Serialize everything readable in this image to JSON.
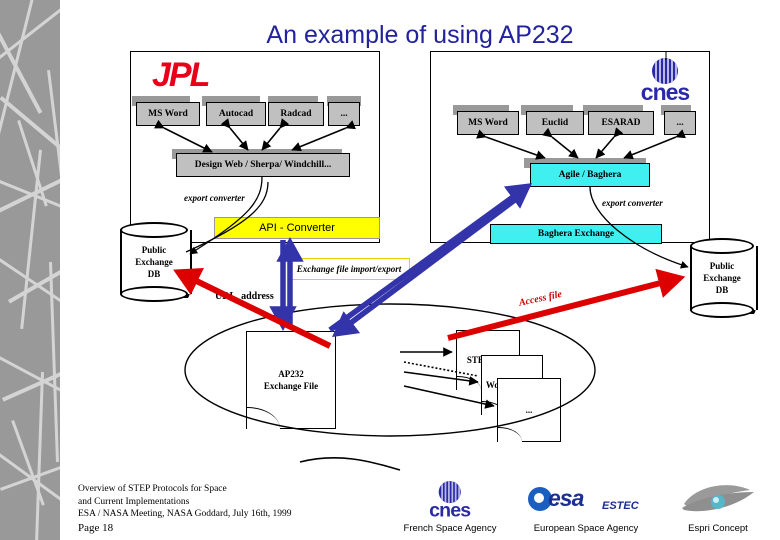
{
  "slide": {
    "title": "An example of using AP232",
    "page_number": "Page 18",
    "footer_line1": "Overview of STEP Protocols for Space",
    "footer_line2": "and Current Implementations",
    "footer_line3": "ESA / NASA Meeting, NASA Goddard, July 16th, 1999",
    "colors": {
      "title": "#22229c",
      "band": "#999999",
      "band_lines": "#d4d4d4",
      "app_box": "#c0c0c0",
      "cyan_box": "#40f0f0",
      "yellow_box": "#ffff00",
      "red_arrow": "#dd0000",
      "blue_arrow": "#3333aa",
      "jpl_red": "#e8001a",
      "cnes_blue": "#2a2aa8"
    }
  },
  "jpl_panel": {
    "logo_text": "JPL",
    "apps": [
      {
        "label": "MS Word"
      },
      {
        "label": "Autocad"
      },
      {
        "label": "Radcad"
      },
      {
        "label": "..."
      }
    ],
    "pdm": "Design Web / Sherpa/ Windchill...",
    "converter_label": "export converter"
  },
  "cnes_panel": {
    "logo_text": "cnes",
    "apps": [
      {
        "label": "MS Word"
      },
      {
        "label": "Euclid"
      },
      {
        "label": "ESARAD"
      },
      {
        "label": "..."
      }
    ],
    "pdm": "Agile / Baghera",
    "exchange": "Baghera Exchange",
    "converter_label": "export converter"
  },
  "middle": {
    "api_converter": "API - Converter",
    "exchange_note": "Exchange file import/export",
    "url_label": "URL, address",
    "access_label": "Access file",
    "ap232_file_line1": "AP232",
    "ap232_file_line2": "Exchange File"
  },
  "databases": [
    {
      "line1": "Public",
      "line2": "Exchange",
      "line3": "DB"
    },
    {
      "line1": "Public",
      "line2": "Exchange",
      "line3": "DB"
    }
  ],
  "documents": [
    {
      "label": "STEP-TAS"
    },
    {
      "label": "Word or PDF"
    },
    {
      "label": "..."
    }
  ],
  "credits": [
    {
      "logo": "cnes-logo",
      "caption": "French Space Agency"
    },
    {
      "logo": "esa-estec-logo",
      "caption": "European Space Agency"
    },
    {
      "logo": "espri-eye-logo",
      "caption": "Espri Concept"
    }
  ]
}
